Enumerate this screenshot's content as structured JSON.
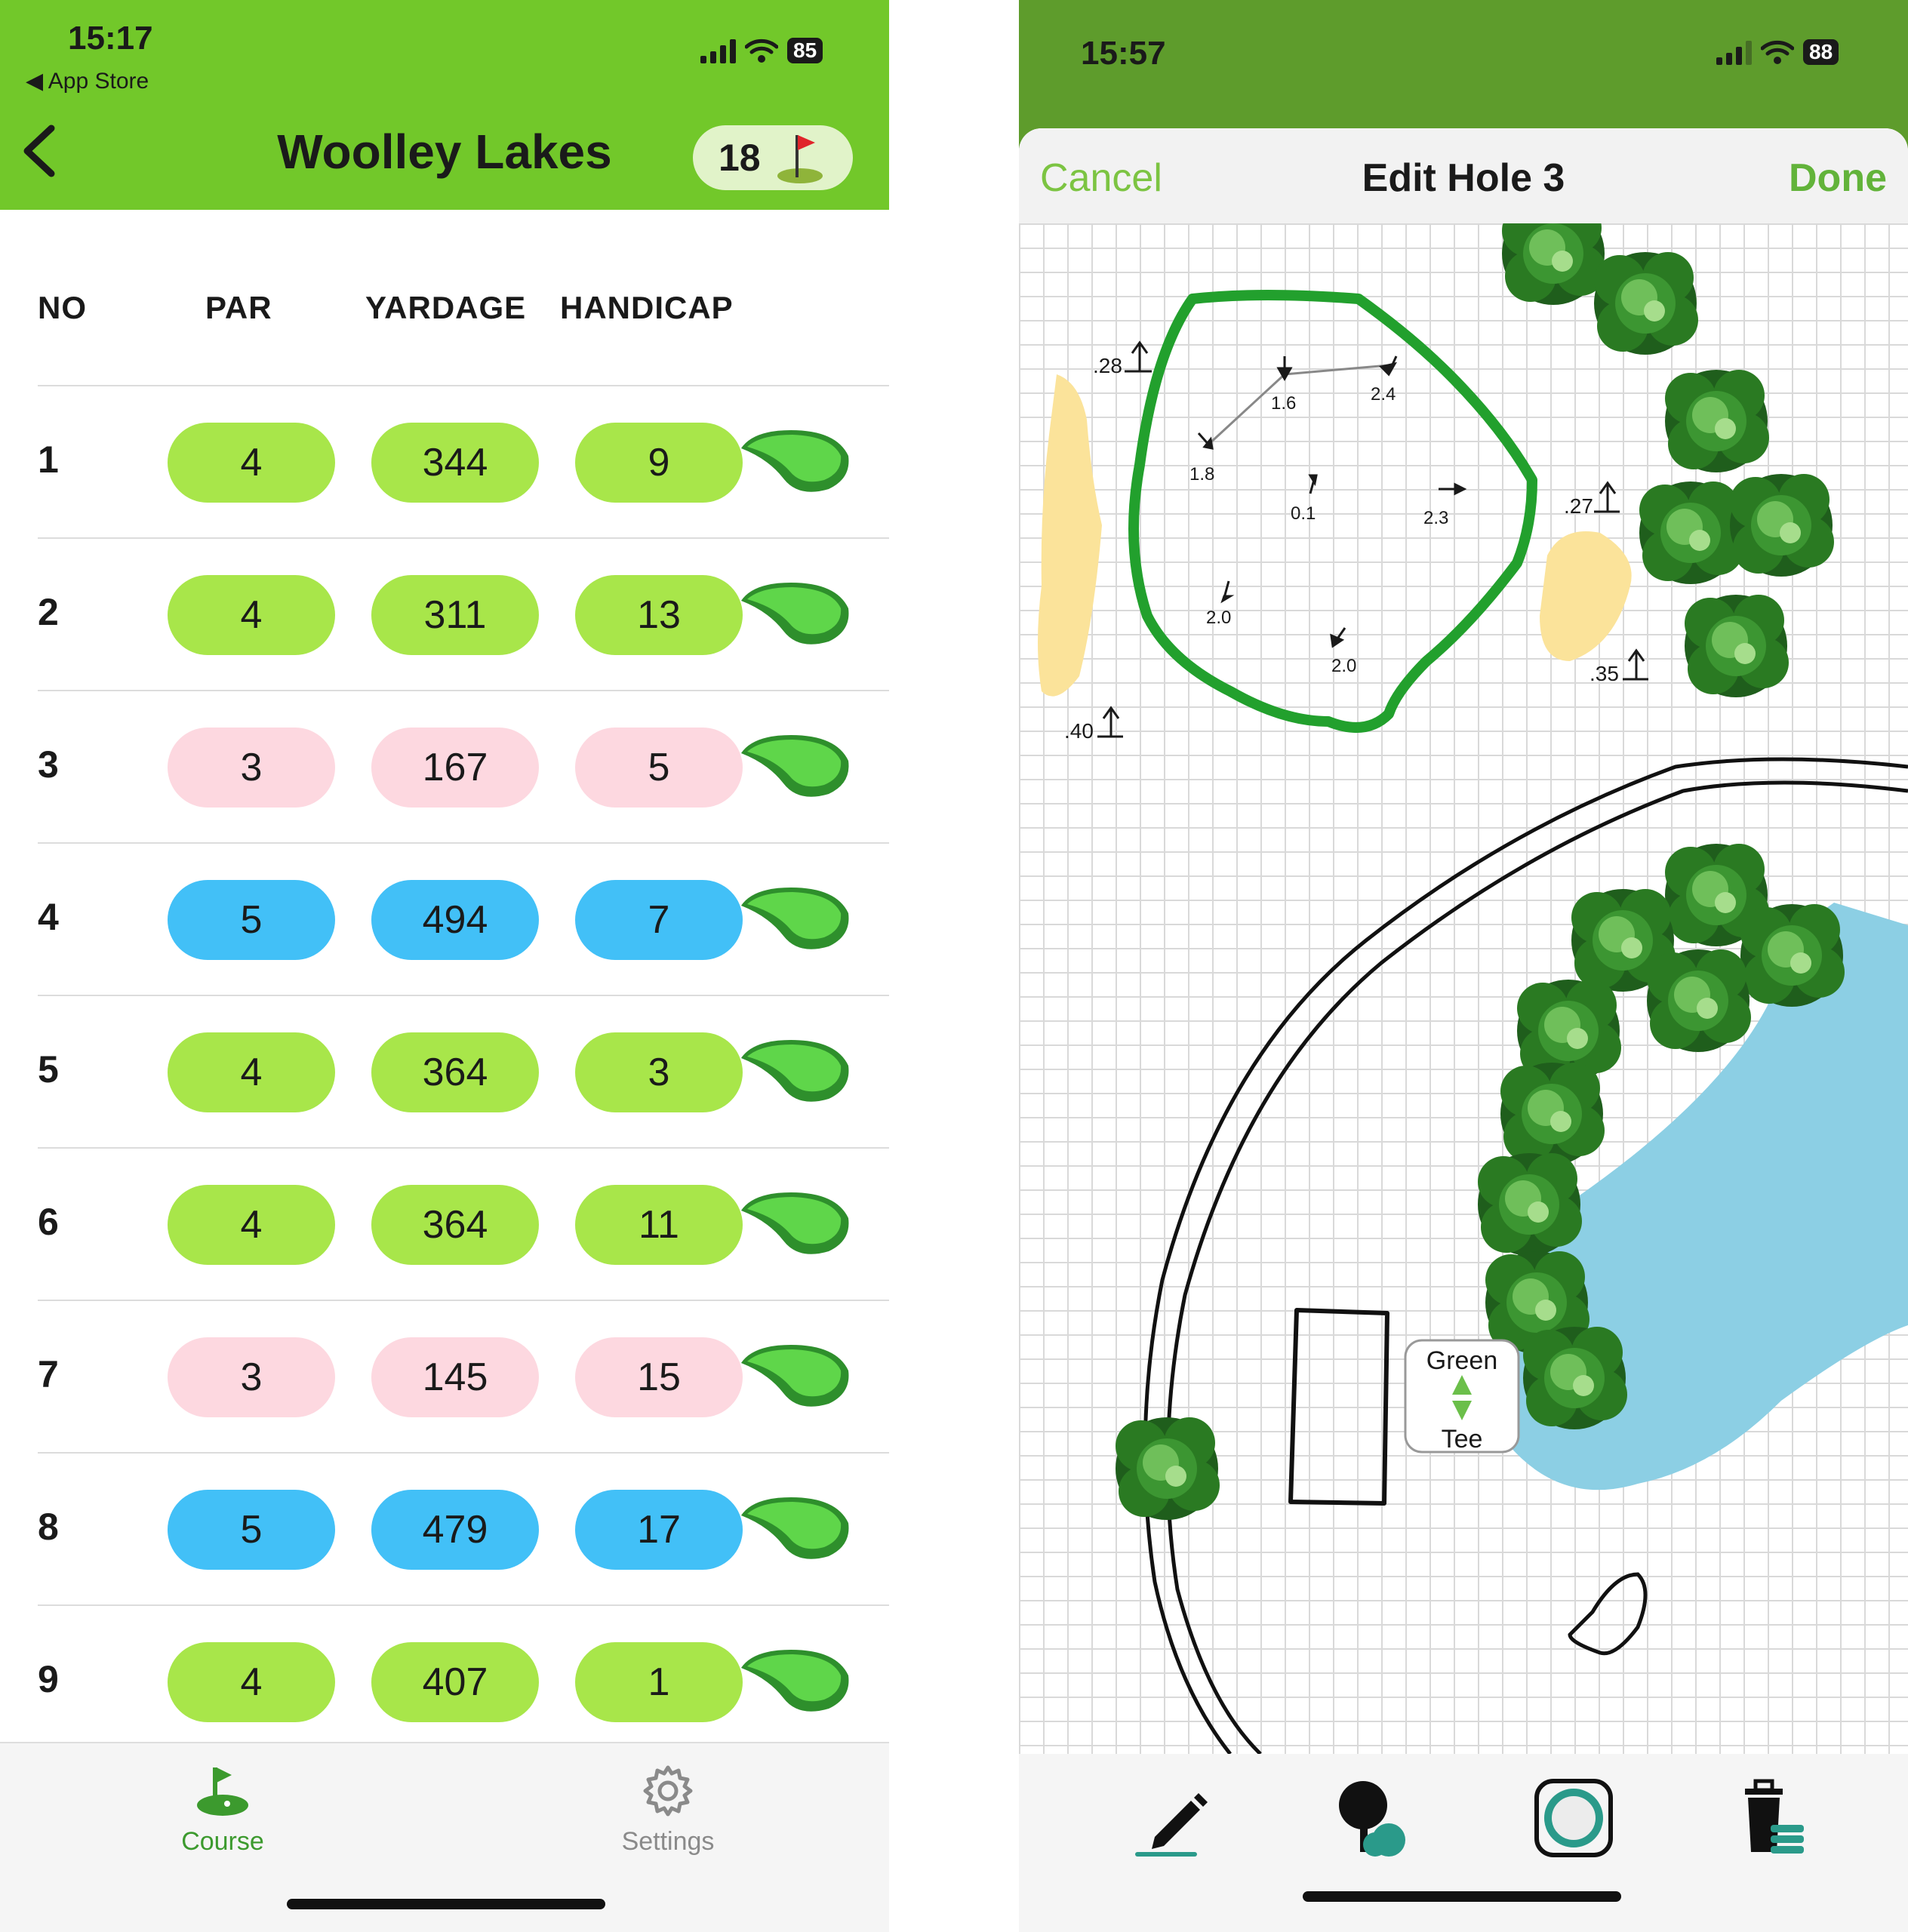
{
  "left": {
    "status": {
      "time": "15:17",
      "back_app": "App Store",
      "battery": "85"
    },
    "header": {
      "title": "Woolley Lakes",
      "holes_count": "18",
      "holes_icon": "golf-flag-icon",
      "back_icon": "chevron-left-icon"
    },
    "columns": {
      "no": "NO",
      "par": "PAR",
      "yardage": "YARDAGE",
      "handicap": "HANDICAP"
    },
    "holes": [
      {
        "no": "1",
        "par": "4",
        "yardage": "344",
        "handicap": "9",
        "color": "green"
      },
      {
        "no": "2",
        "par": "4",
        "yardage": "311",
        "handicap": "13",
        "color": "green"
      },
      {
        "no": "3",
        "par": "3",
        "yardage": "167",
        "handicap": "5",
        "color": "pink"
      },
      {
        "no": "4",
        "par": "5",
        "yardage": "494",
        "handicap": "7",
        "color": "blue"
      },
      {
        "no": "5",
        "par": "4",
        "yardage": "364",
        "handicap": "3",
        "color": "green"
      },
      {
        "no": "6",
        "par": "4",
        "yardage": "364",
        "handicap": "11",
        "color": "green"
      },
      {
        "no": "7",
        "par": "3",
        "yardage": "145",
        "handicap": "15",
        "color": "pink"
      },
      {
        "no": "8",
        "par": "5",
        "yardage": "479",
        "handicap": "17",
        "color": "blue"
      },
      {
        "no": "9",
        "par": "4",
        "yardage": "407",
        "handicap": "1",
        "color": "green"
      }
    ],
    "tabs": {
      "course": "Course",
      "settings": "Settings"
    },
    "colors": {
      "header": "#72c82a",
      "par3": "#fdd8e0",
      "par4": "#a8e64a",
      "par5": "#42c0f7",
      "active_tab": "#3c9a2e",
      "inactive_tab": "#8a8a8a"
    }
  },
  "right": {
    "status": {
      "time": "15:57",
      "battery": "88"
    },
    "nav": {
      "cancel": "Cancel",
      "title": "Edit Hole 3",
      "done": "Done"
    },
    "slopes": [
      "1.6",
      "2.4",
      "1.8",
      "0.1",
      "2.3",
      "2.0",
      "2.0"
    ],
    "distances": [
      ".28",
      ".27",
      ".35",
      ".40"
    ],
    "tee_toggle": {
      "top": "Green",
      "bottom": "Tee"
    },
    "tools": [
      "pencil-icon",
      "tree-icon",
      "circle-shape-icon",
      "trash-icon"
    ],
    "colors": {
      "accent": "#62b33a",
      "water": "#8ccfe4",
      "bunker": "#fbe39a",
      "green_outline": "#22a02d"
    }
  }
}
